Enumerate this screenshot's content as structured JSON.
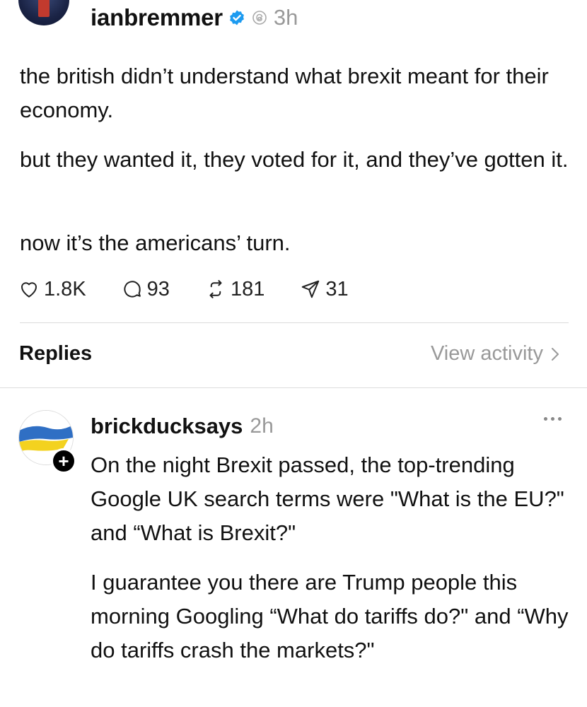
{
  "post": {
    "author": "ianbremmer",
    "time": "3h",
    "paragraphs": [
      "the british didn’t understand what brexit meant for their economy.",
      "but they wanted it, they voted for it, and they’ve gotten it.",
      "now it’s the americans’ turn."
    ],
    "likes": "1.8K",
    "comments": "93",
    "reposts": "181",
    "shares": "31"
  },
  "replies_header": {
    "label": "Replies",
    "view_activity": "View activity"
  },
  "reply": {
    "author": "brickducksays",
    "time": "2h",
    "paragraphs": [
      "On the night Brexit passed, the top-trending Google UK search terms were \"What is the EU?\" and “What is Brexit?\"",
      "I guarantee you there are Trump people this morning Googling “What do tariffs do?\" and “Why do tariffs crash the markets?\""
    ]
  },
  "colors": {
    "verified": "#1d9bf0",
    "muted_text": "#999999",
    "divider": "#dcdcdc"
  },
  "icons": [
    "heart-icon",
    "comment-icon",
    "repost-icon",
    "share-icon",
    "verified-badge-icon",
    "threads-icon",
    "chevron-right-icon",
    "more-icon",
    "plus-icon"
  ]
}
